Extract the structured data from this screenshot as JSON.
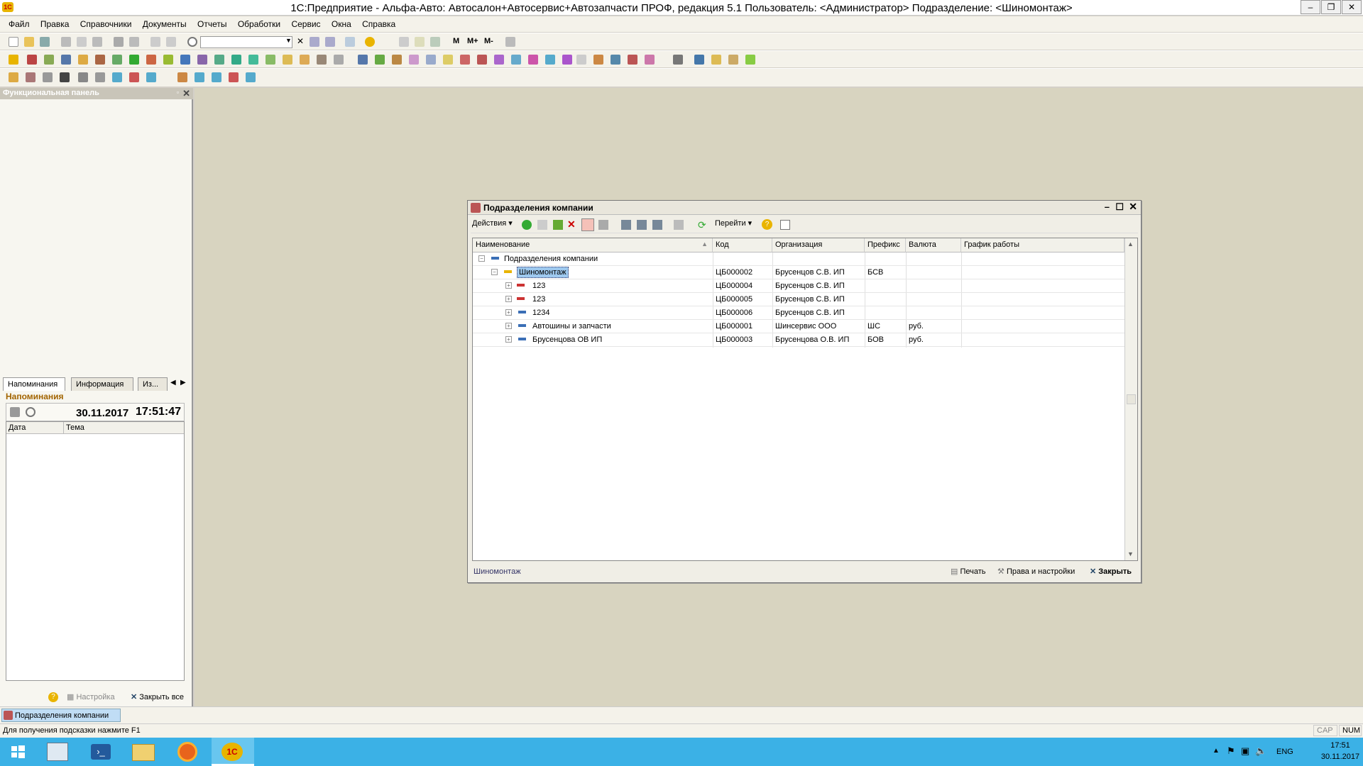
{
  "window": {
    "title": "1С:Предприятие - Альфа-Авто: Автосалон+Автосервис+Автозапчасти ПРОФ, редакция 5.1    Пользователь: <Администратор>    Подразделение: <Шиномонтаж>"
  },
  "menu": [
    "Файл",
    "Правка",
    "Справочники",
    "Документы",
    "Отчеты",
    "Обработки",
    "Сервис",
    "Окна",
    "Справка"
  ],
  "toolbar": {
    "mem": [
      "M",
      "M+",
      "M-"
    ]
  },
  "left_panel": {
    "title": "Функциональная панель",
    "tabs": [
      "Напоминания",
      "Информация",
      "Из..."
    ],
    "reminders_title": "Напоминания",
    "date": "30.11.2017",
    "time": "17:51:47",
    "columns": [
      "Дата",
      "Тема"
    ],
    "settings_label": "Настройка",
    "close_all_label": "Закрыть все"
  },
  "dialog": {
    "title": "Подразделения компании",
    "actions_label": "Действия",
    "goto_label": "Перейти",
    "columns": [
      "Наименование",
      "Код",
      "Организация",
      "Префикс",
      "Валюта",
      "График работы"
    ],
    "rows": [
      {
        "name": "Подразделения компании",
        "code": "",
        "org": "",
        "prefix": "",
        "currency": ""
      },
      {
        "name": "Шиномонтаж",
        "code": "ЦБ000002",
        "org": "Брусенцов С.В. ИП",
        "prefix": "БСВ",
        "currency": ""
      },
      {
        "name": "123",
        "code": "ЦБ000004",
        "org": "Брусенцов С.В. ИП",
        "prefix": "",
        "currency": ""
      },
      {
        "name": "123",
        "code": "ЦБ000005",
        "org": "Брусенцов С.В. ИП",
        "prefix": "",
        "currency": ""
      },
      {
        "name": "1234",
        "code": "ЦБ000006",
        "org": "Брусенцов С.В. ИП",
        "prefix": "",
        "currency": ""
      },
      {
        "name": "Автошины и запчасти",
        "code": "ЦБ000001",
        "org": "Шинсервис ООО",
        "prefix": "ШС",
        "currency": "руб."
      },
      {
        "name": "Брусенцова ОВ ИП",
        "code": "ЦБ000003",
        "org": "Брусенцова О.В. ИП",
        "prefix": "БОВ",
        "currency": "руб."
      }
    ],
    "footer_selected": "Шиномонтаж",
    "print_label": "Печать",
    "rights_label": "Права и настройки",
    "close_label": "Закрыть"
  },
  "taskstrip": {
    "item": "Подразделения компании"
  },
  "status": {
    "hint": "Для получения подсказки нажмите F1",
    "cap": "CAP",
    "num": "NUM"
  },
  "taskbar": {
    "lang": "ENG",
    "time": "17:51",
    "date": "30.11.2017"
  },
  "colors": {
    "accent": "#3bb1e6",
    "selection": "#9ec9ef"
  }
}
